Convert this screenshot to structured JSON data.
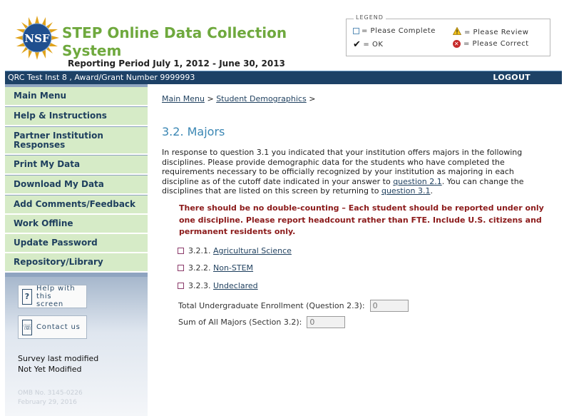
{
  "header": {
    "logo_text": "NSF",
    "title": "STEP Online Data Collection System",
    "reporting_period": "Reporting Period July 1, 2012 - June 30, 2013"
  },
  "legend": {
    "title": "LEGEND",
    "items": [
      {
        "icon": "square-icon",
        "label": "= Please Complete"
      },
      {
        "icon": "warning-icon",
        "label": "= Please Review"
      },
      {
        "icon": "check-icon",
        "label": "= OK"
      },
      {
        "icon": "error-icon",
        "label": "= Please Correct"
      }
    ]
  },
  "topbar": {
    "institution": "QRC Test Inst 8 , Award/Grant Number 9999993",
    "logout": "LOGOUT"
  },
  "sidebar": {
    "menu": [
      {
        "label": "Main Menu"
      },
      {
        "label": "Help & Instructions"
      },
      {
        "label": "Partner Institution Responses"
      },
      {
        "label": "Print My Data"
      },
      {
        "label": "Download My Data"
      },
      {
        "label": "Add Comments/Feedback"
      },
      {
        "label": "Work Offline"
      },
      {
        "label": "Update Password"
      },
      {
        "label": "Repository/Library"
      }
    ],
    "tools": {
      "help": {
        "label": "Help with this screen",
        "icon": "question-icon"
      },
      "contact": {
        "label": "Contact us",
        "icon": "phone-icon"
      }
    },
    "survey": {
      "line1": "Survey last modified",
      "line2": "Not Yet Modified"
    },
    "omb": {
      "line1": "OMB No. 3145-0226",
      "line2": "February 29, 2016"
    }
  },
  "main": {
    "breadcrumb": {
      "item1": "Main Menu",
      "sep1": " > ",
      "item2": "Student Demographics",
      "sep2": " >"
    },
    "title": "3.2. Majors",
    "intro": {
      "part1": "In response to question 3.1 you indicated that your institution offers majors in the following disciplines. Please provide demographic data for the students who have completed the requirements necessary to be officially recognized by your institution as majoring in each discipline as of the cutoff date indicated in your answer to ",
      "link1": "question 2.1",
      "part2": ". You can change the disciplines that are listed on this screen by returning to ",
      "link2": "question 3.1",
      "part3": "."
    },
    "warning": "There should be no double-counting – Each student should be reported under only one discipline. Please report headcount rather than FTE. Include U.S. citizens and permanent residents only.",
    "disciplines": [
      {
        "number": "3.2.1.",
        "label": "Agricultural Science"
      },
      {
        "number": "3.2.2.",
        "label": "Non-STEM"
      },
      {
        "number": "3.2.3.",
        "label": "Undeclared"
      }
    ],
    "fields": {
      "total_enrollment": {
        "label": "Total Undergraduate Enrollment (Question 2.3):",
        "value": "0"
      },
      "sum_majors": {
        "label": "Sum of All Majors (Section 3.2):",
        "value": "0"
      }
    }
  },
  "colors": {
    "brand_green": "#6fa93e",
    "nav_blue": "#1d4166",
    "menu_bg": "#d6ebc7",
    "title_blue": "#3b87b4",
    "warning_red": "#8b1a1a"
  }
}
